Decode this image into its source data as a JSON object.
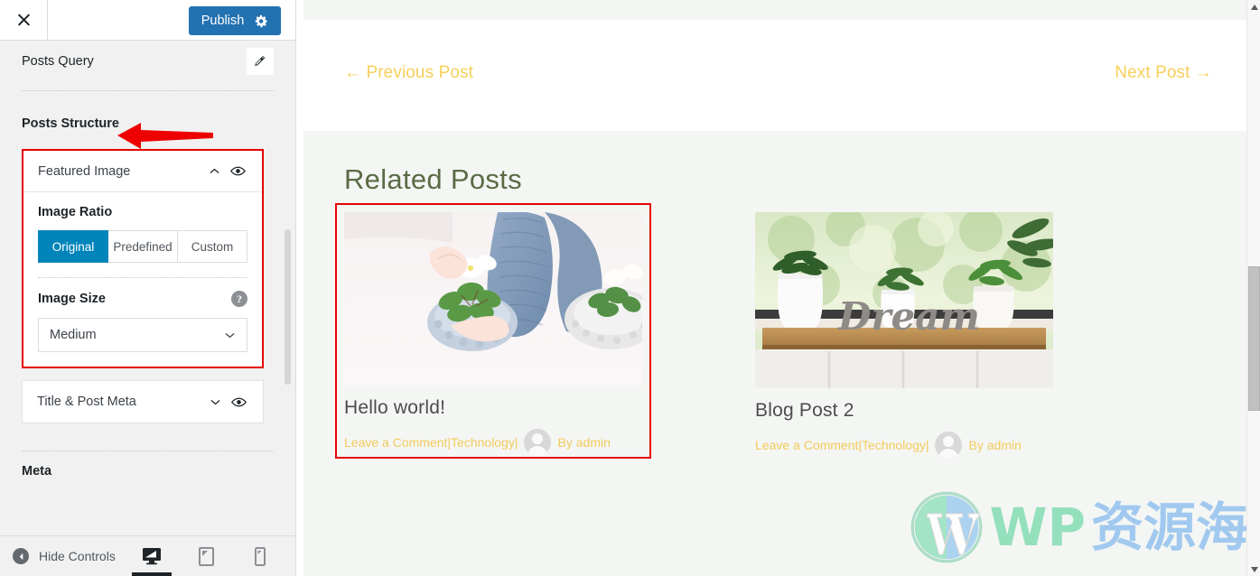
{
  "sidebar": {
    "topbar": {
      "close_icon": "close-icon",
      "publish_label": "Publish",
      "settings_icon": "gear-icon"
    },
    "posts_query": {
      "label": "Posts Query",
      "edit_icon": "pencil-icon"
    },
    "posts_structure": {
      "title": "Posts Structure"
    },
    "featured_image_panel": {
      "title": "Featured Image",
      "collapse_icon": "chevron-up-icon",
      "visibility_icon": "eye-icon",
      "image_ratio": {
        "label": "Image Ratio",
        "options": [
          "Original",
          "Predefined",
          "Custom"
        ],
        "selected": "Original"
      },
      "image_size": {
        "label": "Image Size",
        "help_icon": "question-mark-icon",
        "value": "Medium",
        "dropdown_icon": "chevron-down-icon"
      }
    },
    "title_post_meta_panel": {
      "title": "Title & Post Meta",
      "expand_icon": "chevron-down-icon",
      "visibility_icon": "eye-icon"
    },
    "meta_section": {
      "title": "Meta"
    },
    "bottom_bar": {
      "hide_controls_label": "Hide Controls",
      "collapse_icon": "chevron-left-icon",
      "devices": [
        {
          "name": "desktop-icon",
          "label": "Desktop",
          "active": true
        },
        {
          "name": "tablet-icon",
          "label": "Tablet",
          "active": false
        },
        {
          "name": "mobile-icon",
          "label": "Mobile",
          "active": false
        }
      ]
    }
  },
  "preview": {
    "post_nav": {
      "previous": "← Previous Post",
      "next": "Next Post →"
    },
    "related": {
      "heading": "Related Posts",
      "posts": [
        {
          "title": "Hello world!",
          "meta_comment": "Leave a Comment",
          "meta_separator_1": " | ",
          "meta_category": "Technology",
          "meta_separator_2": " | ",
          "meta_author": "By admin",
          "image_alt": "Hands in blue sweater planting flowers in crochet baskets",
          "highlighted": true
        },
        {
          "title": "Blog Post 2",
          "meta_comment": "Leave a Comment",
          "meta_separator_1": " | ",
          "meta_category": "Technology",
          "meta_separator_2": " | ",
          "meta_author": "By admin",
          "image_alt": "Three white potted plants on wooden windowsill with Dream sign",
          "highlighted": false
        }
      ]
    },
    "watermark": {
      "logo_icon": "wordpress-logo-icon",
      "text_latin": "WP",
      "text_cjk": "资源海"
    }
  },
  "colors": {
    "publish_blue": "#2271b1",
    "selected_blue": "#0085ba",
    "annotation_red": "#e60000",
    "link_gold": "#f2cb5c",
    "heading_green": "#5a6b45",
    "preview_bg": "#f4f6f4"
  }
}
